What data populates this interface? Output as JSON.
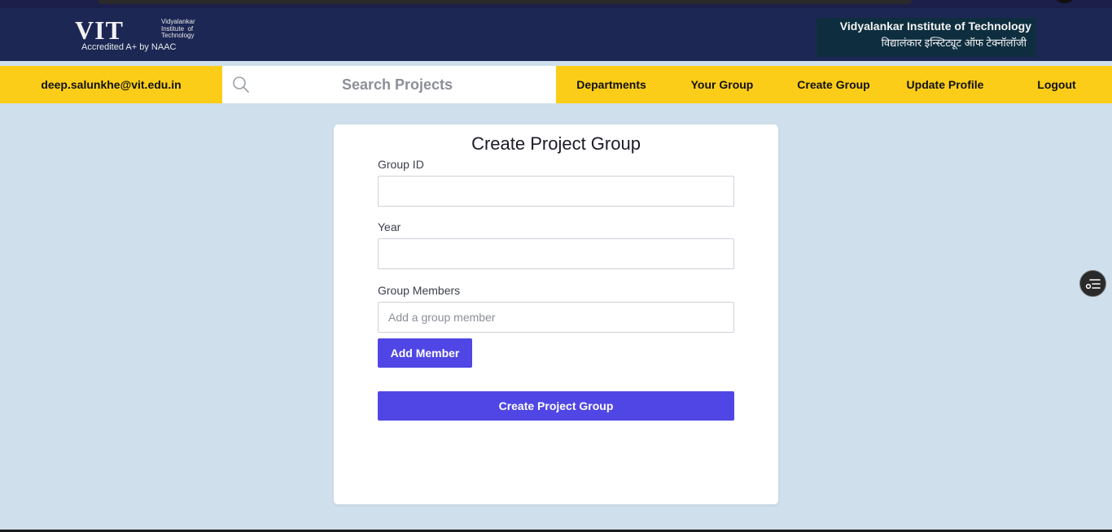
{
  "brand": {
    "logo_mark": "VIT",
    "logo_lines": [
      "Vidyalankar",
      "Institute  of",
      "Technology"
    ],
    "logo_accreditation": "Accredited A+ by NAAC",
    "institute_name_en": "Vidyalankar Institute of Technology",
    "institute_name_hi": "विद्यालंकार इन्स्टिट्यूट ऑफ टेक्नॉलॉजी"
  },
  "navbar": {
    "user_email": "deep.salunkhe@vit.edu.in",
    "search_placeholder": "Search Projects",
    "links": [
      "Departments",
      "Your Group",
      "Create Group",
      "Update Profile",
      "Logout"
    ]
  },
  "form": {
    "title": "Create Project Group",
    "group_id_label": "Group ID",
    "group_id_value": "",
    "year_label": "Year",
    "year_value": "",
    "members_label": "Group Members",
    "members_placeholder": "Add a group member",
    "add_member_button": "Add Member",
    "submit_button": "Create Project Group"
  },
  "colors": {
    "header_bg": "#1c2754",
    "navbar_bg": "#fbcd19",
    "page_bg": "#cfdfeb",
    "accent": "#4f46e5"
  },
  "icons": [
    "search-icon",
    "list-settings-icon"
  ]
}
